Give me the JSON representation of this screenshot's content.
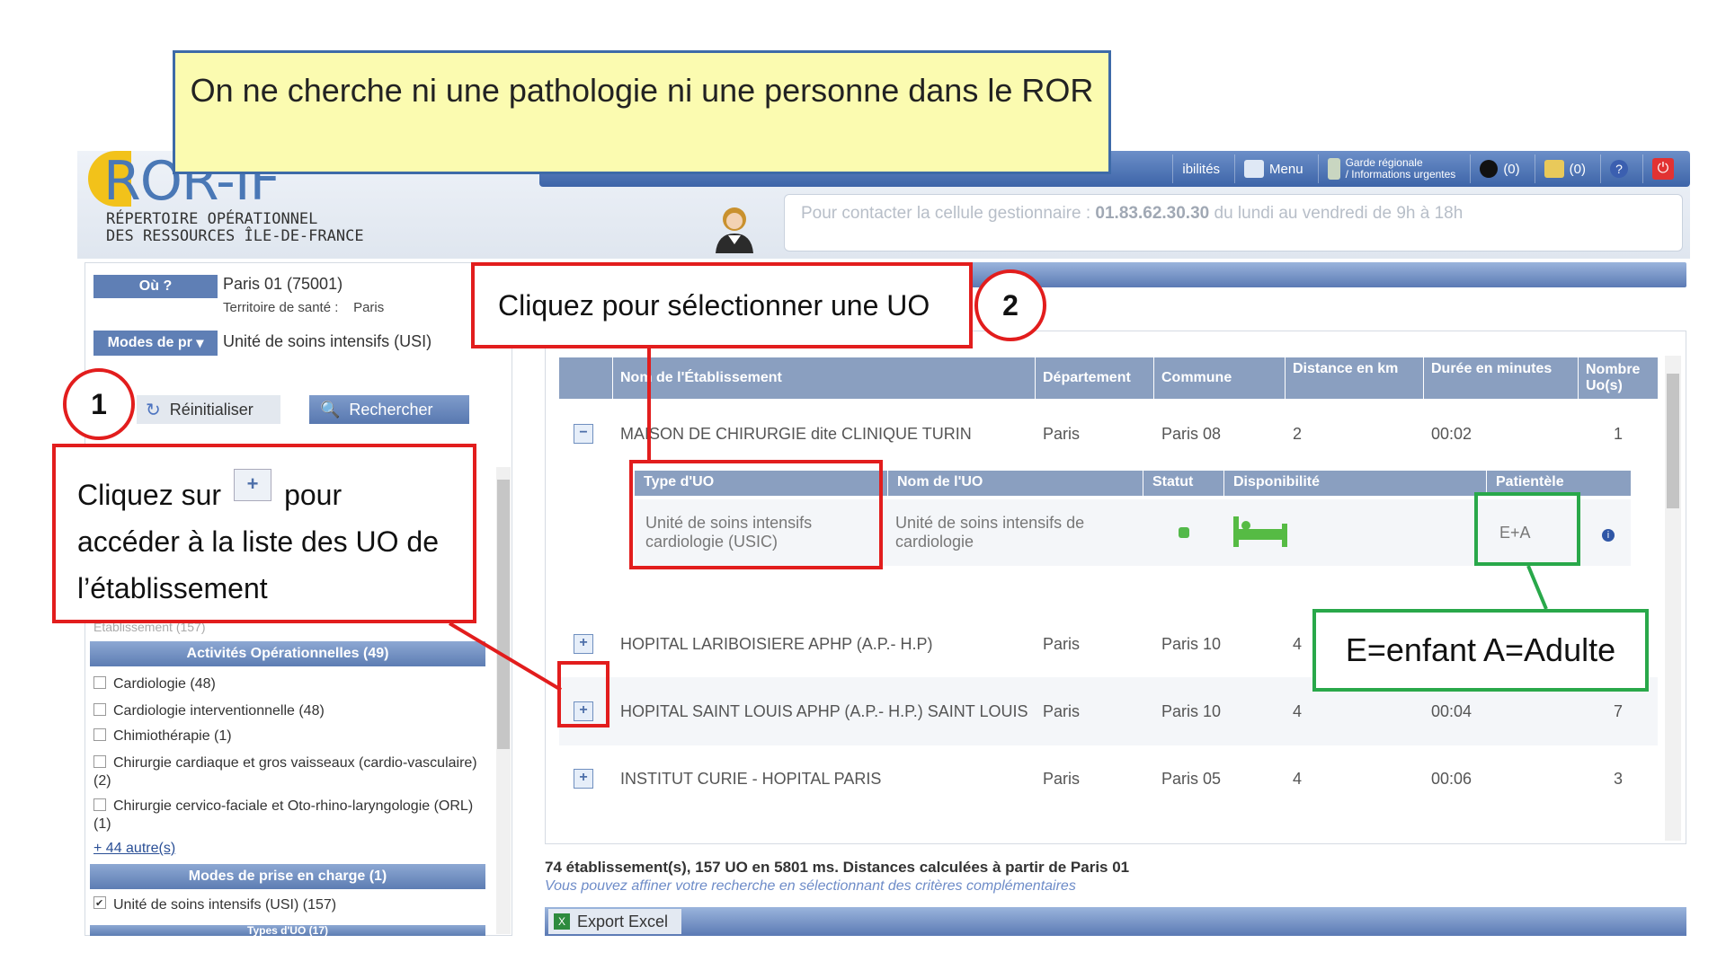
{
  "annotations": {
    "yellow_note": "On ne cherche ni une pathologie ni une personne dans le ROR",
    "callout_2": "Cliquez pour sélectionner une UO",
    "circle_2": "2",
    "circle_1": "1",
    "callout_1_before": "Cliquez sur",
    "callout_1_after": "pour accéder à la liste des UO de l’établissement",
    "enfant_adulte": "E=enfant A=Adulte",
    "plus_symbol": "+"
  },
  "app": {
    "logo_title": "ROR-IF",
    "logo_sub1": "RÉPERTOIRE OPÉRATIONNEL",
    "logo_sub2": "DES RESSOURCES ÎLE-DE-FRANCE",
    "topbar": {
      "disponibilites": "ibilités",
      "menu": "Menu",
      "garde_line1": "Garde régionale",
      "garde_line2": "/ Informations urgentes",
      "count1": "(0)",
      "count2": "(0)"
    },
    "contact_prefix": "Pour contacter la cellule gestionnaire :",
    "contact_phone": "01.83.62.30.30",
    "contact_suffix": "du lundi au vendredi de 9h à 18h"
  },
  "search": {
    "ou_label": "Où ?",
    "ou_value": "Paris 01 (75001)",
    "territoire_label": "Territoire de santé :",
    "territoire_value": "Paris",
    "modes_label": "Modes de pr",
    "modes_value": "Unité de soins intensifs (USI)",
    "reset_label": "Réinitialiser",
    "search_label": "Rechercher"
  },
  "facets": {
    "etablissement_partial": "Etablissement (157)",
    "activites_title": "Activités Opérationnelles (49)",
    "activites": [
      "Cardiologie (48)",
      "Cardiologie interventionnelle (48)",
      "Chimiothérapie (1)",
      "Chirurgie cardiaque et gros vaisseaux (cardio-vasculaire) (2)",
      "Chirurgie cervico-faciale et Oto-rhino-laryngologie (ORL) (1)"
    ],
    "more": "+ 44 autre(s)",
    "modes_title": "Modes de prise en charge (1)",
    "modes_item": "Unité de soins intensifs (USI) (157)",
    "types_partial": "Types d'UO (17)"
  },
  "table": {
    "headers": [
      "Nom de l'Établissement",
      "Département",
      "Commune",
      "Distance en km",
      "Durée en minutes",
      "Nombre Uo(s)"
    ],
    "rows": [
      {
        "name": "MAISON DE CHIRURGIE dite CLINIQUE TURIN",
        "dept": "Paris",
        "commune": "Paris 08",
        "distance": "2",
        "duree": "00:02",
        "nb": "1",
        "toggle": "−"
      },
      {
        "name": "HOPITAL LARIBOISIERE APHP (A.P.- H.P)",
        "dept": "Paris",
        "commune": "Paris 10",
        "distance": "4",
        "duree": "",
        "nb": "",
        "toggle": "+"
      },
      {
        "name": "HOPITAL SAINT LOUIS APHP (A.P.- H.P.) SAINT LOUIS",
        "dept": "Paris",
        "commune": "Paris 10",
        "distance": "4",
        "duree": "00:04",
        "nb": "7",
        "toggle": "+"
      },
      {
        "name": "INSTITUT CURIE - HOPITAL PARIS",
        "dept": "Paris",
        "commune": "Paris 05",
        "distance": "4",
        "duree": "00:06",
        "nb": "3",
        "toggle": "+"
      }
    ],
    "sub_headers": [
      "Type d'UO",
      "Nom de l'UO",
      "Statut",
      "Disponibilité",
      "Patientèle"
    ],
    "sub_row": {
      "type": "Unité de soins intensifs cardiologie (USIC)",
      "nom": "Unité de soins intensifs de cardiologie",
      "patientele": "E+A"
    }
  },
  "footer": {
    "summary": "74 établissement(s), 157 UO en 5801 ms. Distances calculées à partir de Paris 01",
    "hint": "Vous pouvez affiner votre recherche en sélectionnant des critères complémentaires",
    "export": "Export Excel"
  },
  "colors": {
    "accent_blue": "#5f7fb5",
    "red": "#e21d1d",
    "green": "#29a84a",
    "yellow": "#fbfbb0"
  }
}
